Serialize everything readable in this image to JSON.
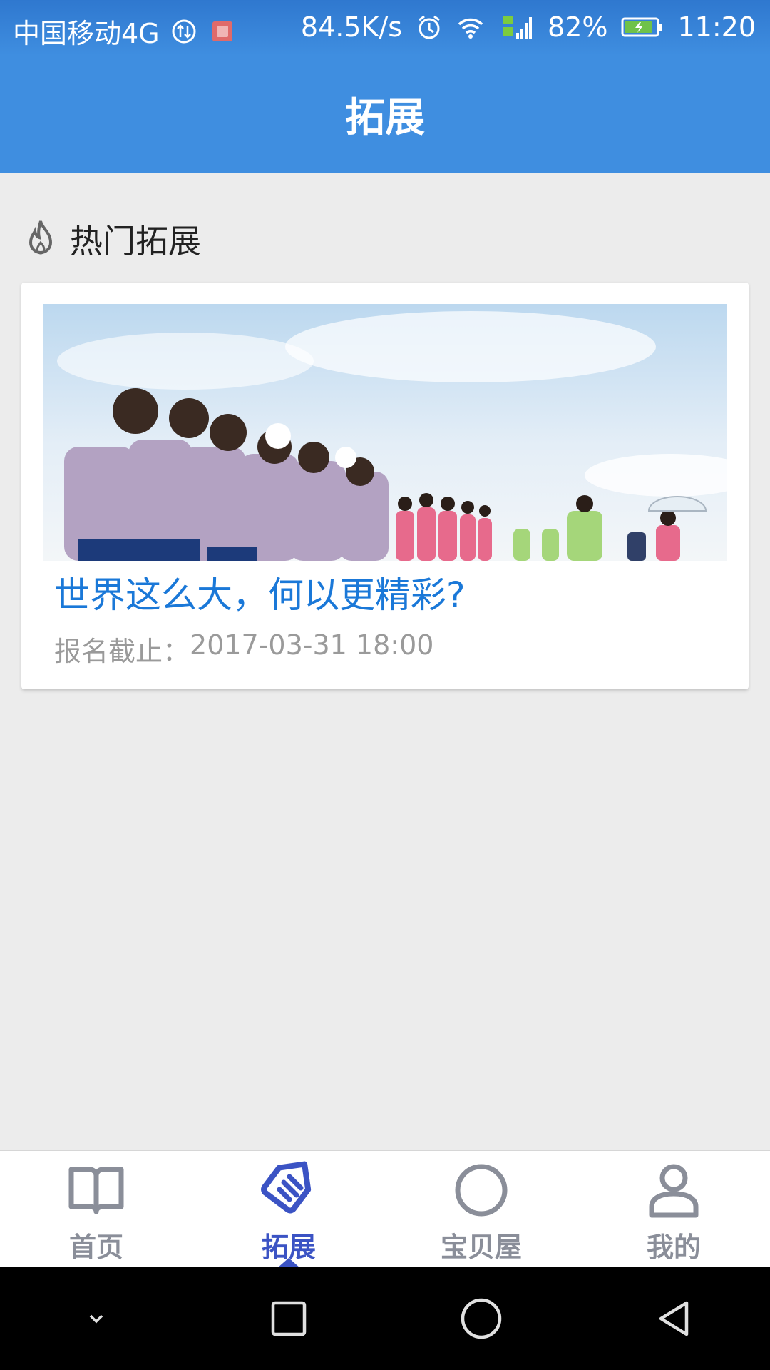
{
  "status_bar": {
    "carrier": "中国移动4G",
    "net_speed": "84.5K/s",
    "battery": "82%",
    "time": "11:20"
  },
  "app_bar": {
    "title": "拓展"
  },
  "section": {
    "title": "热门拓展"
  },
  "card": {
    "title": "世界这么大，何以更精彩?",
    "deadline_label": "报名截止：",
    "deadline_value": "2017-03-31 18:00"
  },
  "bottom_nav": {
    "items": [
      {
        "label": "首页",
        "icon": "book-icon"
      },
      {
        "label": "拓展",
        "icon": "tag-icon"
      },
      {
        "label": "宝贝屋",
        "icon": "circle-icon"
      },
      {
        "label": "我的",
        "icon": "person-icon"
      }
    ],
    "active_index": 1
  },
  "colors": {
    "primary": "#3f8ee0",
    "active_tab": "#3b53c4",
    "title_blue": "#1a78d8"
  }
}
